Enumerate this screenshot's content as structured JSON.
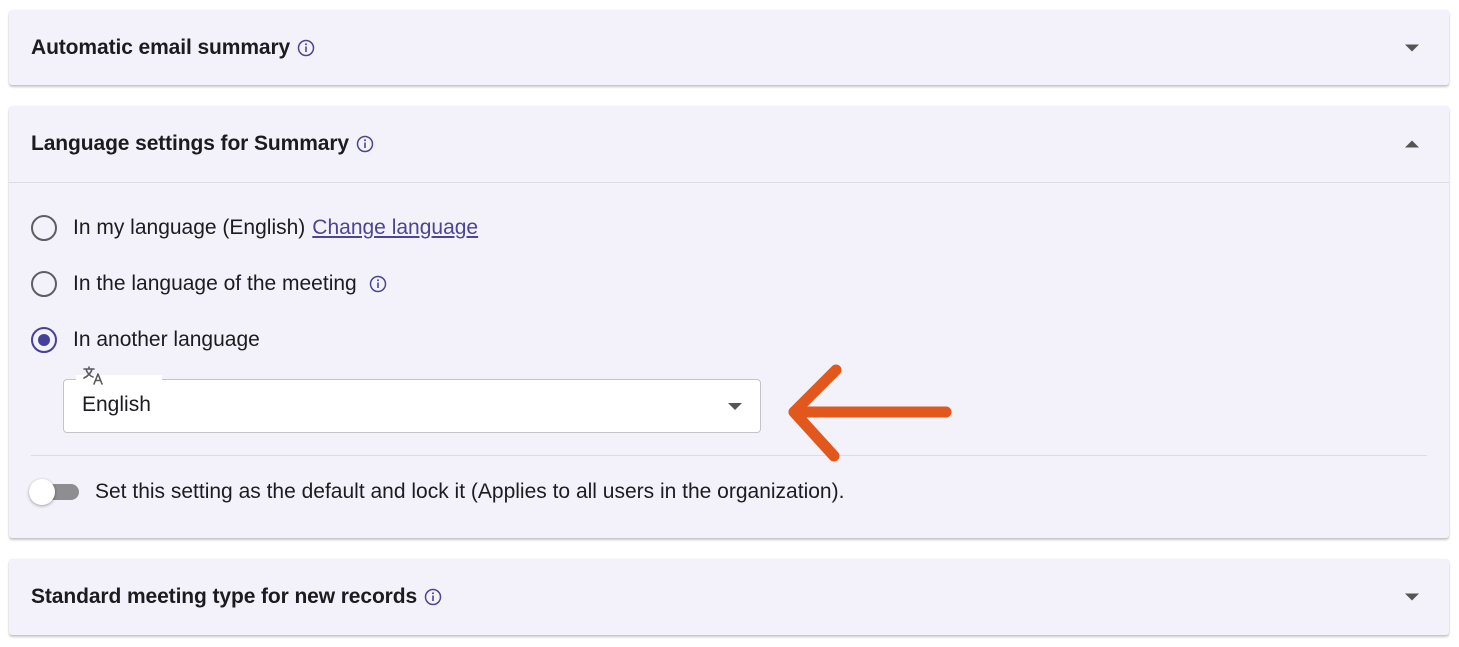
{
  "panels": {
    "email_summary": {
      "title": "Automatic email summary",
      "expanded": false
    },
    "language_settings": {
      "title": "Language settings for Summary",
      "expanded": true,
      "options": [
        {
          "label": "In my language (English)",
          "link": "Change language",
          "checked": false
        },
        {
          "label": "In the language of the meeting",
          "checked": false
        },
        {
          "label": "In another language",
          "checked": true
        }
      ],
      "language_select": {
        "value": "English",
        "icon": "translate-icon"
      },
      "lock_toggle": {
        "label": "Set this setting as the default and lock it (Applies to all users in the organization).",
        "on": false
      }
    },
    "meeting_type": {
      "title": "Standard meeting type for new records",
      "expanded": false
    }
  },
  "colors": {
    "panel_bg": "#f3f2fa",
    "accent": "#45419b",
    "annotation_arrow": "#e2571b"
  }
}
